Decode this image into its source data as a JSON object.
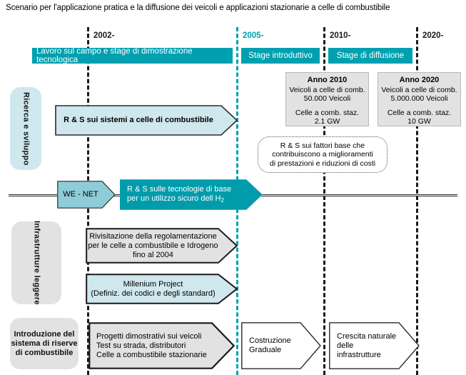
{
  "title": "Scenario per l'applicazione pratica e la diffusione dei veicoli e applicazioni stazionarie a celle di combustibile",
  "colors": {
    "teal": "#00A0B0",
    "light_blue": "#cfe8ee",
    "grey": "#e2e2e2",
    "black": "#1a1a1a",
    "white": "#ffffff"
  },
  "timeline": {
    "years": [
      {
        "label": "2002-",
        "color": "black"
      },
      {
        "label": "2005-",
        "color": "teal"
      },
      {
        "label": "2010-",
        "color": "black"
      },
      {
        "label": "2020-",
        "color": "black"
      }
    ],
    "stages": [
      {
        "label": "Lavoro sul campo e stage di dimostrazione tecnologica"
      },
      {
        "label": "Stage introduttivo"
      },
      {
        "label": "Stage di diffusione"
      }
    ]
  },
  "info_boxes": [
    {
      "heading": "Anno 2010",
      "line1": "Veicoli a celle di comb.",
      "line2": "50.000 Veicoli",
      "line3": "Celle a comb. staz.",
      "line4": "2.1 GW"
    },
    {
      "heading": "Anno 2020",
      "line1": "Veicoli a celle di comb.",
      "line2": "5.000.000 Veicoli",
      "line3": "Celle a comb. staz.",
      "line4": "10 GW"
    }
  ],
  "categories": [
    {
      "label": "Ricerca e sviluppo",
      "style": "blue",
      "orientation": "vertical"
    },
    {
      "label": "Infrastrutture leggere",
      "style": "grey",
      "orientation": "vertical"
    },
    {
      "label": "Introduzione del sistema di riserve di combustibile",
      "style": "grey",
      "orientation": "horizontal"
    }
  ],
  "arrows": {
    "rs_sistemi": "R & S sui sistemi a celle di combustibile",
    "we_net": "WE - NET",
    "rs_tecnologie_line1": "R & S sulle tecnologie di base",
    "rs_tecnologie_line2_a": "per un utilizzo sicuro dell H",
    "rs_tecnologie_line2_sub": "2",
    "rivisitazione_line1": "Rivisitazione della regolamentazione",
    "rivisitazione_line2": "per le celle a combustibile e Idrogeno",
    "rivisitazione_line3": "fino al 2004",
    "millenium_line1": "Millenium Project",
    "millenium_line2": "(Definiz. dei codici e degli standard)",
    "progetti_line1": "Progetti dimostrativi sui veicoli",
    "progetti_line2": "Test su strada, distributori",
    "progetti_line3": "Celle a combustibile stazionarie",
    "costruzione_line1": "Costruzione",
    "costruzione_line2": "Graduale",
    "crescita_line1": "Crescita naturale",
    "crescita_line2": "delle infrastrutture"
  },
  "callout": {
    "line1": "R & S sui fattori base che",
    "line2": "contribuiscono a miglioramenti",
    "line3": "di prestazioni e riduzioni di costi"
  }
}
